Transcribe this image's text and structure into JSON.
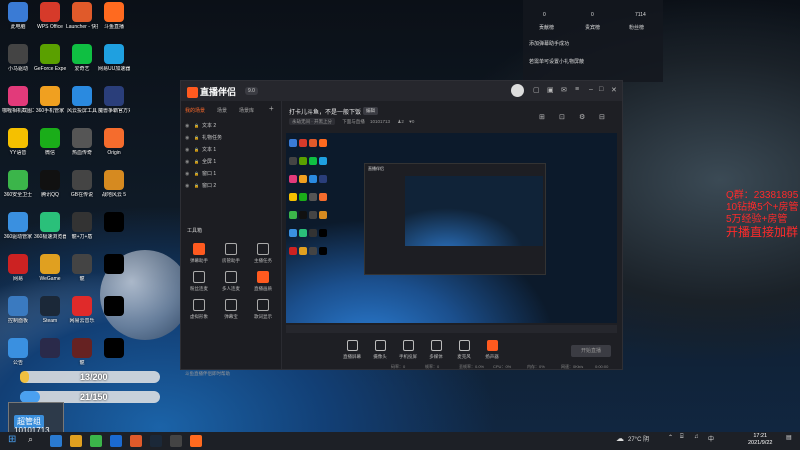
{
  "desktop": {
    "icons": [
      {
        "label": "此电脑",
        "color": "#3a7bd5"
      },
      {
        "label": "WPS Office",
        "color": "#d63a2a"
      },
      {
        "label": "Launcher - 快捷方式",
        "color": "#e05a2a"
      },
      {
        "label": "斗鱼直播",
        "color": "#ff6a1f"
      },
      {
        "label": "小马驱动",
        "color": "#444"
      },
      {
        "label": "GeForce Experience",
        "color": "#5aa000"
      },
      {
        "label": "爱奇艺",
        "color": "#0fbf42"
      },
      {
        "label": "网易UU加速器",
        "color": "#1fa0e0"
      },
      {
        "label": "咖喱相机截图工具",
        "color": "#e23a7a"
      },
      {
        "label": "360手机管家",
        "color": "#f0a020"
      },
      {
        "label": "风云投屏工具",
        "color": "#2a8ae0"
      },
      {
        "label": "魔兽争霸官方对战平台",
        "color": "#2a3e7a"
      },
      {
        "label": "YY语音",
        "color": "#f5c000"
      },
      {
        "label": "微信",
        "color": "#1aad19"
      },
      {
        "label": "热血传奇",
        "color": "#555"
      },
      {
        "label": "Origin",
        "color": "#f56c2d"
      },
      {
        "label": "360安全卫士",
        "color": "#3bb54a"
      },
      {
        "label": "腾讯QQ",
        "color": "#111"
      },
      {
        "label": "GB在传说",
        "color": "#444"
      },
      {
        "label": "战地风云 5",
        "color": "#d68a20"
      },
      {
        "label": "360驱动管家",
        "color": "#3a90e0"
      },
      {
        "label": "360极速浏览器",
        "color": "#2ac07a"
      },
      {
        "label": "龍+刀+盾",
        "color": "#333"
      },
      {
        "label": "",
        "color": "#000"
      },
      {
        "label": "网易",
        "color": "#c22"
      },
      {
        "label": "WeGame",
        "color": "#e0a020"
      },
      {
        "label": "龍",
        "color": "#444"
      },
      {
        "label": "",
        "color": "#000"
      },
      {
        "label": "控制面板",
        "color": "#3a7ac0"
      },
      {
        "label": "Steam",
        "color": "#1b2838"
      },
      {
        "label": "网易云音乐",
        "color": "#e02a2a"
      },
      {
        "label": "",
        "color": "#000"
      },
      {
        "label": "公告",
        "color": "#3a90e0"
      },
      {
        "label": "",
        "color": "#2a2a4a"
      },
      {
        "label": "龍",
        "color": "#662222"
      },
      {
        "label": "",
        "color": "#000"
      }
    ],
    "progress1": {
      "text": "13/200",
      "value": 0.065
    },
    "progress2": {
      "text": "21/150",
      "value": 0.14
    },
    "streamer_badge": "超管组",
    "streamer_id": "10101713",
    "red_info": [
      "Q群：23381895",
      "10钻换5个+房管",
      "5万经验+房管",
      "开播直接加群"
    ],
    "top_panel": {
      "stats": [
        "0",
        "0",
        "7114"
      ],
      "tabs": [
        "贡献榜",
        "贵宾榜",
        "粉丝榜"
      ],
      "msg1": "添加弹幕助手成功",
      "msg2": "若需单可设置小礼物屏蔽"
    }
  },
  "app": {
    "title": "直播伴侣",
    "version": "9.0",
    "left_tabs": [
      "我的场景",
      "场景",
      "场景库"
    ],
    "sources": [
      "文本 2",
      "礼物任务",
      "文本 1",
      "全屏 1",
      "窗口 1",
      "窗口 2"
    ],
    "tools_title": "工具箱",
    "tools": [
      {
        "label": "弹幕助手",
        "hot": true
      },
      {
        "label": "房管助手",
        "hot": false
      },
      {
        "label": "主播任务",
        "hot": false
      },
      {
        "label": "粉丝连麦",
        "hot": false
      },
      {
        "label": "多人连麦",
        "hot": false
      },
      {
        "label": "直播画质",
        "hot": true
      },
      {
        "label": "虚拟形象",
        "hot": false
      },
      {
        "label": "弹幕宝",
        "hot": false
      },
      {
        "label": "歌词显示",
        "hot": false
      }
    ],
    "status_text": "斗鱼直播伴侣即时帮助",
    "stream_title": "打卡儿斗鱼，不是一般下饭",
    "edit_label": "编辑",
    "category": "永劫无间 · 开黑上分",
    "room_label": "下面与直播",
    "room_id": "10101713",
    "counts": [
      "2",
      "0"
    ],
    "bottom_buttons": [
      {
        "label": "直播屏幕",
        "red": false
      },
      {
        "label": "摄像头",
        "red": false
      },
      {
        "label": "手机投屏",
        "red": false
      },
      {
        "label": "多媒体",
        "red": false
      },
      {
        "label": "麦克风",
        "red": false
      },
      {
        "label": "扬声器",
        "red": true
      }
    ],
    "go_live": "开始直播",
    "stats": [
      "码率：0",
      "帧率：0",
      "丢帧率：0.0%",
      "CPU：0%",
      "内存：0%",
      "网速：0Kb/s",
      "0:00:00"
    ]
  },
  "taskbar": {
    "icon_colors": [
      "#2a7ad0",
      "#e0a020",
      "#3bb54a",
      "#1b6ad0",
      "#e05a2a",
      "#1b2838",
      "#444",
      "#ff6a1f"
    ],
    "weather": "27°C 阴",
    "time": "17:21",
    "date": "2021/9/22"
  }
}
